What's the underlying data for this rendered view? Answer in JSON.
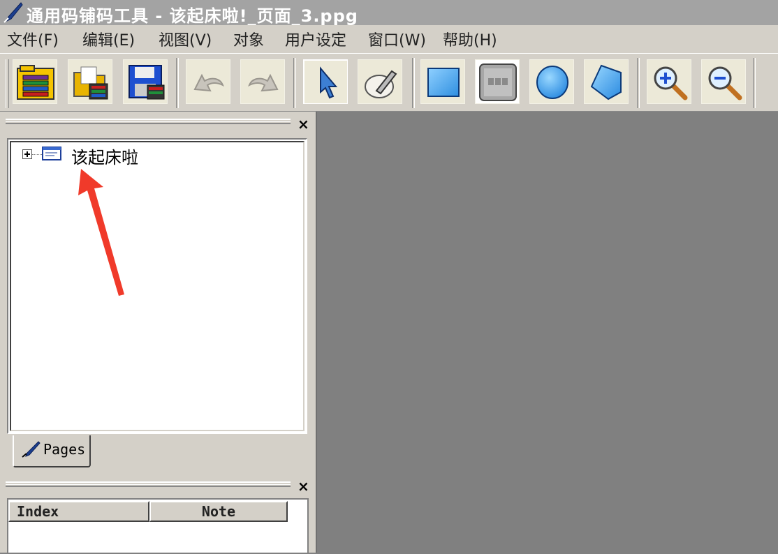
{
  "titlebar": {
    "title": "通用码铺码工具 - 该起床啦!_页面_3.ppg",
    "icon": "quill-pen-icon"
  },
  "menu": {
    "items": [
      {
        "label": "文件(F)"
      },
      {
        "label": "编辑(E)"
      },
      {
        "label": "视图(V)"
      },
      {
        "label": "对象"
      },
      {
        "label": "用户设定"
      },
      {
        "label": "窗口(W)"
      },
      {
        "label": "帮助(H)"
      }
    ]
  },
  "toolbar": {
    "buttons": [
      {
        "icon": "new-file-icon"
      },
      {
        "icon": "open-folder-icon"
      },
      {
        "icon": "save-disk-icon"
      },
      {
        "icon": "undo-icon"
      },
      {
        "icon": "redo-icon"
      },
      {
        "icon": "select-arrow-icon"
      },
      {
        "icon": "pen-tool-icon"
      },
      {
        "icon": "rectangle-icon"
      },
      {
        "icon": "image-placeholder-icon"
      },
      {
        "icon": "ellipse-icon"
      },
      {
        "icon": "polygon-icon"
      },
      {
        "icon": "zoom-in-icon"
      },
      {
        "icon": "zoom-out-icon"
      }
    ],
    "active_tool": "select-arrow-icon"
  },
  "pages_panel": {
    "tree": {
      "root_label": "该起床啦",
      "expanded": false
    },
    "tab_label": "Pages",
    "close_label": "×"
  },
  "notes_panel": {
    "columns": [
      {
        "label": "Index"
      },
      {
        "label": "Note"
      }
    ],
    "close_label": "×"
  },
  "colors": {
    "annotation_arrow": "#f03a2a",
    "canvas_bg": "#808080",
    "chrome": "#d4d0c8"
  }
}
